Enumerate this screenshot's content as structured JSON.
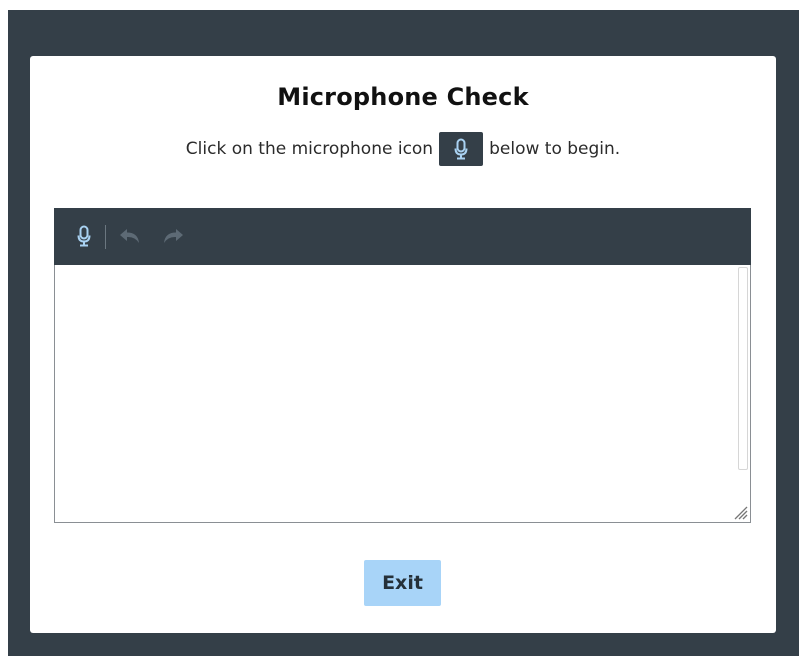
{
  "dialog": {
    "title": "Microphone Check",
    "instruction_before": "Click on the microphone icon",
    "instruction_after": "below to begin.",
    "inline_icon": "microphone-icon"
  },
  "editor": {
    "toolbar": {
      "buttons": [
        {
          "icon": "microphone-icon",
          "enabled": true
        },
        {
          "icon": "undo-icon",
          "enabled": false
        },
        {
          "icon": "redo-icon",
          "enabled": false
        }
      ]
    },
    "text_value": ""
  },
  "footer": {
    "exit_label": "Exit"
  },
  "colors": {
    "backdrop": "#343f48",
    "toolbar": "#343f48",
    "icon_blue": "#a9d2f2",
    "icon_disabled": "#5d6a75",
    "exit_button": "#a8d4f8"
  }
}
